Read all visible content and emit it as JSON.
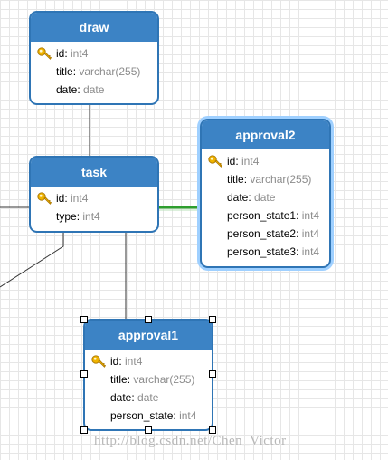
{
  "entities": {
    "draw": {
      "name": "draw",
      "fields": [
        {
          "name": "id",
          "type": "int4",
          "key": true
        },
        {
          "name": "title",
          "type": "varchar(255)",
          "key": false
        },
        {
          "name": "date",
          "type": "date",
          "key": false
        }
      ]
    },
    "task": {
      "name": "task",
      "fields": [
        {
          "name": "id",
          "type": "int4",
          "key": true
        },
        {
          "name": "type",
          "type": "int4",
          "key": false
        }
      ]
    },
    "approval2": {
      "name": "approval2",
      "fields": [
        {
          "name": "id",
          "type": "int4",
          "key": true
        },
        {
          "name": "title",
          "type": "varchar(255)",
          "key": false
        },
        {
          "name": "date",
          "type": "date",
          "key": false
        },
        {
          "name": "person_state1",
          "type": "int4",
          "key": false
        },
        {
          "name": "person_state2",
          "type": "int4",
          "key": false
        },
        {
          "name": "person_state3",
          "type": "int4",
          "key": false
        }
      ]
    },
    "approval1": {
      "name": "approval1",
      "fields": [
        {
          "name": "id",
          "type": "int4",
          "key": true
        },
        {
          "name": "title",
          "type": "varchar(255)",
          "key": false
        },
        {
          "name": "date",
          "type": "date",
          "key": false
        },
        {
          "name": "person_state",
          "type": "int4",
          "key": false
        }
      ]
    }
  },
  "separator": ": ",
  "watermark": "http://blog.csdn.net/Chen_Victor",
  "icons": {
    "key": "key-icon"
  },
  "colors": {
    "header": "#3c83c5",
    "border": "#2f75b5",
    "selection_glow": "#9fd0ff",
    "highlight_link": "#2e9e2e",
    "type_text": "#8c8c8c"
  }
}
